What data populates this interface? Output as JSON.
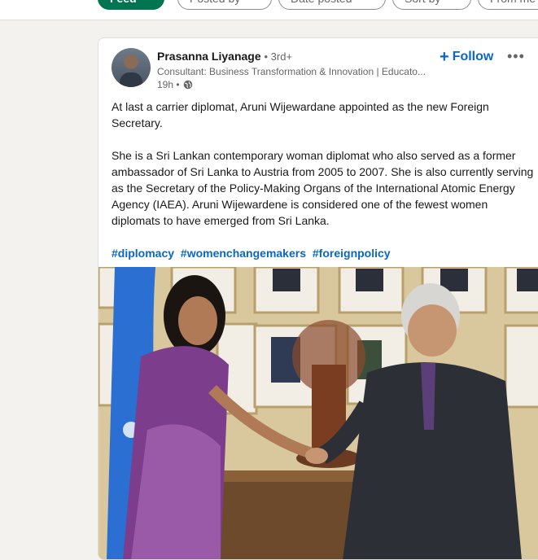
{
  "filters": [
    "Feed",
    "Posted by",
    "Date posted",
    "Sort by",
    "From me"
  ],
  "post": {
    "author_name": "Prasanna Liyanage",
    "degree": "• 3rd+",
    "headline": "Consultant: Business Transformation & Innovation | Educato...",
    "time": "19h •",
    "follow_label": "Follow",
    "more_label": "•••",
    "paragraphs": [
      "At last a carrier diplomat, Aruni Wijewardane appointed as the new Foreign Secretary.",
      "She is a Sri Lankan contemporary woman diplomat who also served as a former ambassador of Sri Lanka to Austria from 2005 to 2007. She is also currently serving as the Secretary of the Policy-Making Organs of the International Atomic Energy Agency (IAEA). Aruni Wijewardene is considered one of the fewest women diplomats to have emerged from Sri Lanka."
    ],
    "hashtags": [
      "#diplomacy",
      "#womenchangemakers",
      "#foreignpolicy"
    ]
  },
  "colors": {
    "accent": "#0a66c2",
    "feed_green": "#01754f"
  }
}
